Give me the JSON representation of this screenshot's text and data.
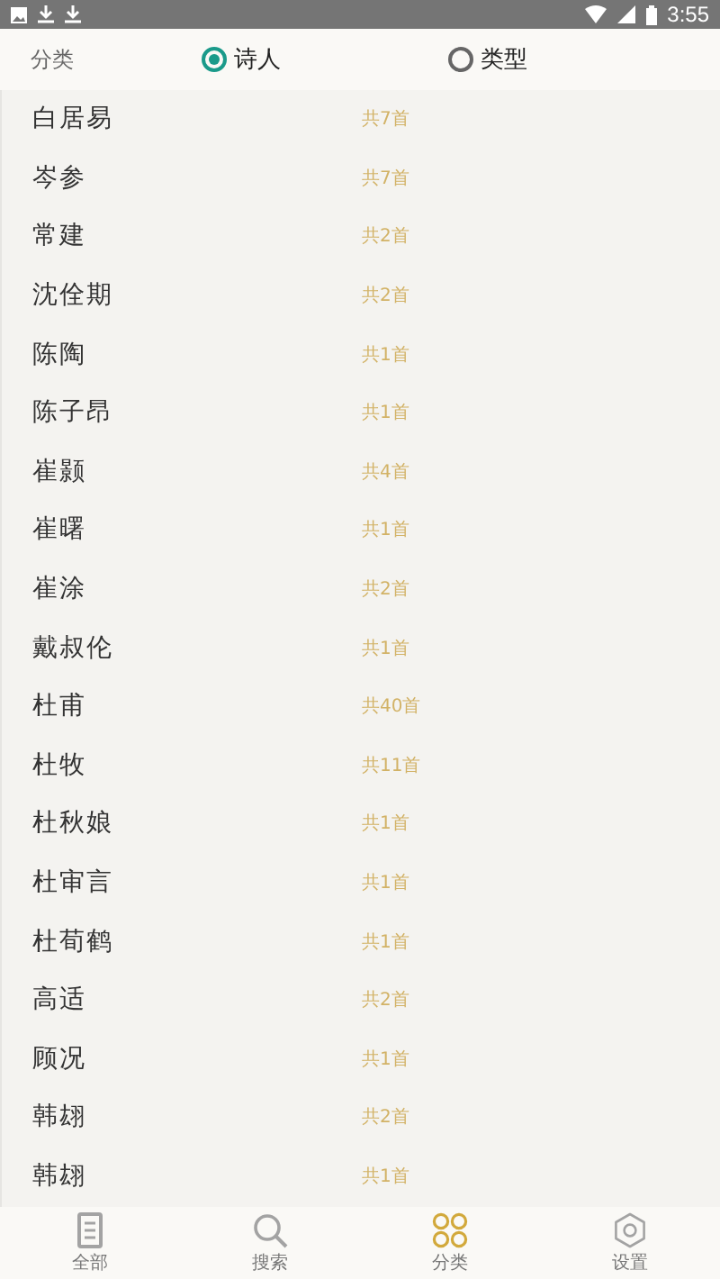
{
  "status_bar": {
    "time": "3:55"
  },
  "filter": {
    "label": "分类",
    "options": [
      {
        "label": "诗人",
        "selected": true
      },
      {
        "label": "类型",
        "selected": false
      }
    ]
  },
  "poets": [
    {
      "name": "白居易",
      "count": "共7首"
    },
    {
      "name": "岑参",
      "count": "共7首"
    },
    {
      "name": "常建",
      "count": "共2首"
    },
    {
      "name": "沈佺期",
      "count": "共2首"
    },
    {
      "name": "陈陶",
      "count": "共1首"
    },
    {
      "name": "陈子昂",
      "count": "共1首"
    },
    {
      "name": "崔颢",
      "count": "共4首"
    },
    {
      "name": "崔曙",
      "count": "共1首"
    },
    {
      "name": "崔涂",
      "count": "共2首"
    },
    {
      "name": "戴叔伦",
      "count": "共1首"
    },
    {
      "name": "杜甫",
      "count": "共40首"
    },
    {
      "name": "杜牧",
      "count": "共11首"
    },
    {
      "name": "杜秋娘",
      "count": "共1首"
    },
    {
      "name": "杜审言",
      "count": "共1首"
    },
    {
      "name": "杜荀鹤",
      "count": "共1首"
    },
    {
      "name": "高适",
      "count": "共2首"
    },
    {
      "name": "顾况",
      "count": "共1首"
    },
    {
      "name": "韩翃",
      "count": "共2首"
    },
    {
      "name": "韩翃",
      "count": "共1首"
    }
  ],
  "nav": [
    {
      "kind": "all",
      "label": "全部",
      "selected": false
    },
    {
      "kind": "search",
      "label": "搜索",
      "selected": false
    },
    {
      "kind": "category",
      "label": "分类",
      "selected": true
    },
    {
      "kind": "settings",
      "label": "设置",
      "selected": false
    }
  ]
}
